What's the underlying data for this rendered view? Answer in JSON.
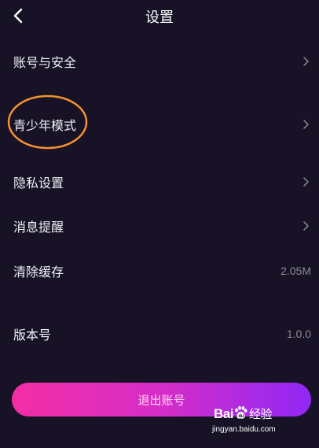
{
  "header": {
    "title": "设置"
  },
  "menu": {
    "account_security": "账号与安全",
    "teen_mode": "青少年模式",
    "privacy_settings": "隐私设置",
    "notifications": "消息提醒",
    "clear_cache": "清除缓存",
    "cache_size": "2.05M",
    "version_label": "版本号",
    "version_value": "1.0.0"
  },
  "logout": {
    "label": "退出账号"
  },
  "watermark": {
    "brand": "Bai",
    "brand_tail": "经验",
    "url": "jingyan.baidu.com"
  },
  "colors": {
    "background": "#171226",
    "highlight_circle": "#f3922e",
    "logout_gradient_start": "#f22ea5",
    "logout_gradient_end": "#9028f4",
    "secondary_text": "#8d889a"
  },
  "icons": {
    "back": "chevron-left-icon",
    "row_arrow": "chevron-right-icon"
  }
}
